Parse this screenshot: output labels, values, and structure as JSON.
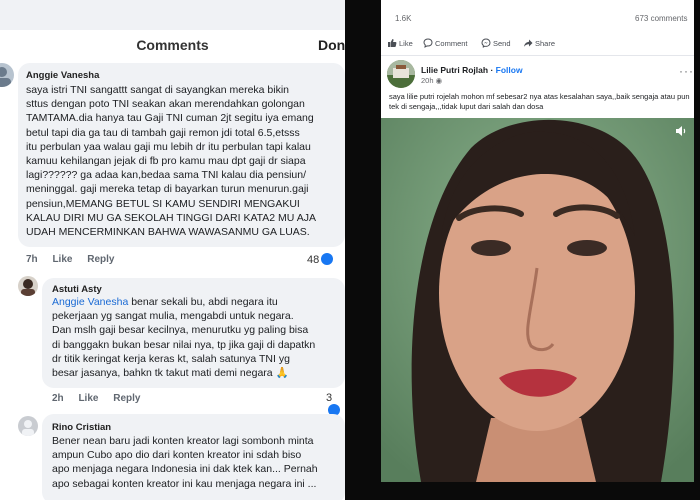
{
  "comments_panel": {
    "title": "Comments",
    "done_label": "Done",
    "comments": [
      {
        "author": "Anggie Vanesha",
        "text": "saya istri TNI sangattt sangat di sayangkan mereka bikin\nsttus dengan poto TNI seakan akan merendahkan golongan\nTAMTAMA.dia hanya tau Gaji TNI cuman 2jt segitu iya emang\nbetul tapi dia ga tau di tambah gaji remon jdi total 6.5,etsss\nitu perbulan yaa walau gaji mu lebih dr itu perbulan tapi kalau\nkamuu kehilangan jejak di fb pro kamu mau dpt gaji dr siapa\nlagi?????? ga adaa kan,bedaa sama TNI kalau dia pensiun/\nmeninggal. gaji mereka tetap di bayarkan turun menurun.gaji\npensiun,MEMANG BETUL SI KAMU SENDIRI MENGAKUI\nKALAU DIRI MU GA SEKOLAH TINGGI DARI KATA2 MU AJA\nUDAH MENCERMINKAN BAHWA WAWASANMU GA LUAS.",
        "time": "7h",
        "like": "Like",
        "reply": "Reply",
        "reactions": "48"
      },
      {
        "author": "Astuti Asty",
        "mention": "Anggie Vanesha",
        "text": " benar sekali bu, abdi negara itu\npekerjaan yg sangat mulia, mengabdi untuk negara.\nDan mslh gaji besar kecilnya, menurutku yg paling bisa\ndi banggakn bukan besar nilai nya, tp jika gaji di dapatkn\ndr titik keringat kerja keras kt, salah satunya TNI yg\nbesar jasanya, bahkn tk takut mati demi negara 🙏",
        "time": "2h",
        "like": "Like",
        "reply": "Reply",
        "reactions": "3"
      },
      {
        "author": "Rino Cristian",
        "text": "Bener nean baru jadi konten kreator lagi sombonh minta\nampun Cubo apo dio dari konten kreator ini sdah biso\napo menjaga negara Indonesia ini dak ktek kan... Pernah\napo sebagai konten kreator ini kau menjaga negara ini ..."
      }
    ]
  },
  "post_panel": {
    "stats_left": "1.6K",
    "stats_right": "673 comments",
    "actions": [
      {
        "label": "Like",
        "icon": "thumbs-up-icon"
      },
      {
        "label": "Comment",
        "icon": "comment-icon"
      },
      {
        "label": "Send",
        "icon": "messenger-icon"
      },
      {
        "label": "Share",
        "icon": "share-icon"
      }
    ],
    "author": "Lilie Putri Rojlah",
    "follow_label": "Follow",
    "time": "20h",
    "text": "saya lilie putri rojelah mohon mf sebesar2 nya atas kesalahan saya,,baik sengaja atau pun tek di sengaja,,,tidak luput dari salah dan dosa",
    "video": {
      "icon": "volume-icon",
      "background": "#6f9c74"
    }
  },
  "colors": {
    "accent": "#1877f2",
    "mention": "#1a6ad4",
    "reaction_red": "#e84a5f"
  }
}
